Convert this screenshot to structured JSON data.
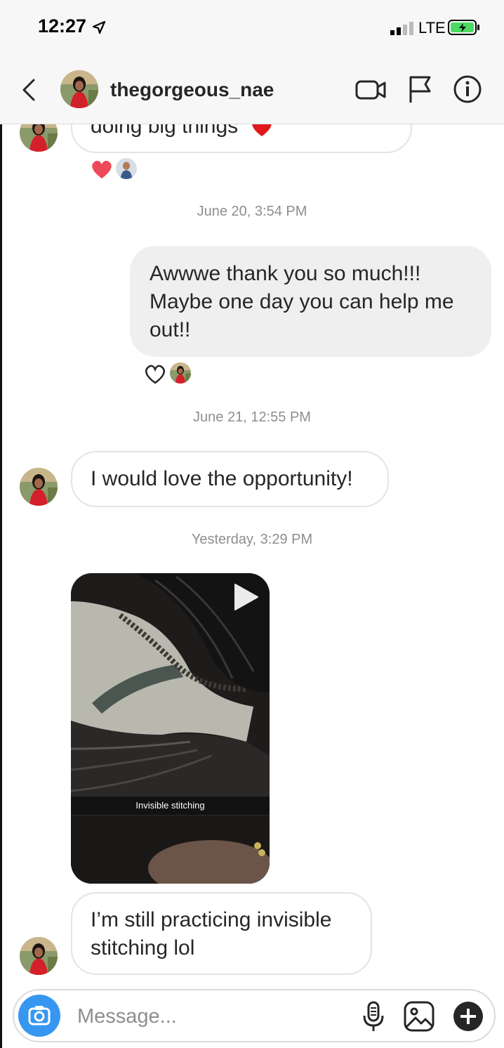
{
  "status_bar": {
    "time": "12:27",
    "network": "LTE"
  },
  "header": {
    "username": "thegorgeous_nae"
  },
  "messages": [
    {
      "text": "doing big things"
    },
    {
      "text": "Awwwe thank you so much!!! Maybe one day you can help me out!!"
    },
    {
      "text": "I would love the opportunity!"
    },
    {
      "text": "I’m still practicing invisible stitching lol"
    }
  ],
  "timestamps": [
    "June 20, 3:54 PM",
    "June 21, 12:55 PM",
    "Yesterday, 3:29 PM"
  ],
  "video": {
    "caption": "Invisible stitching"
  },
  "composer": {
    "placeholder": "Message..."
  },
  "icons": [
    "back-icon",
    "video-call-icon",
    "flag-icon",
    "info-icon",
    "heart-icon",
    "camera-icon",
    "microphone-icon",
    "gallery-icon",
    "plus-icon",
    "play-icon",
    "location-icon"
  ],
  "colors": {
    "heart": "#ed4956",
    "camera": "#3797f0",
    "battery": "#4cd964"
  }
}
